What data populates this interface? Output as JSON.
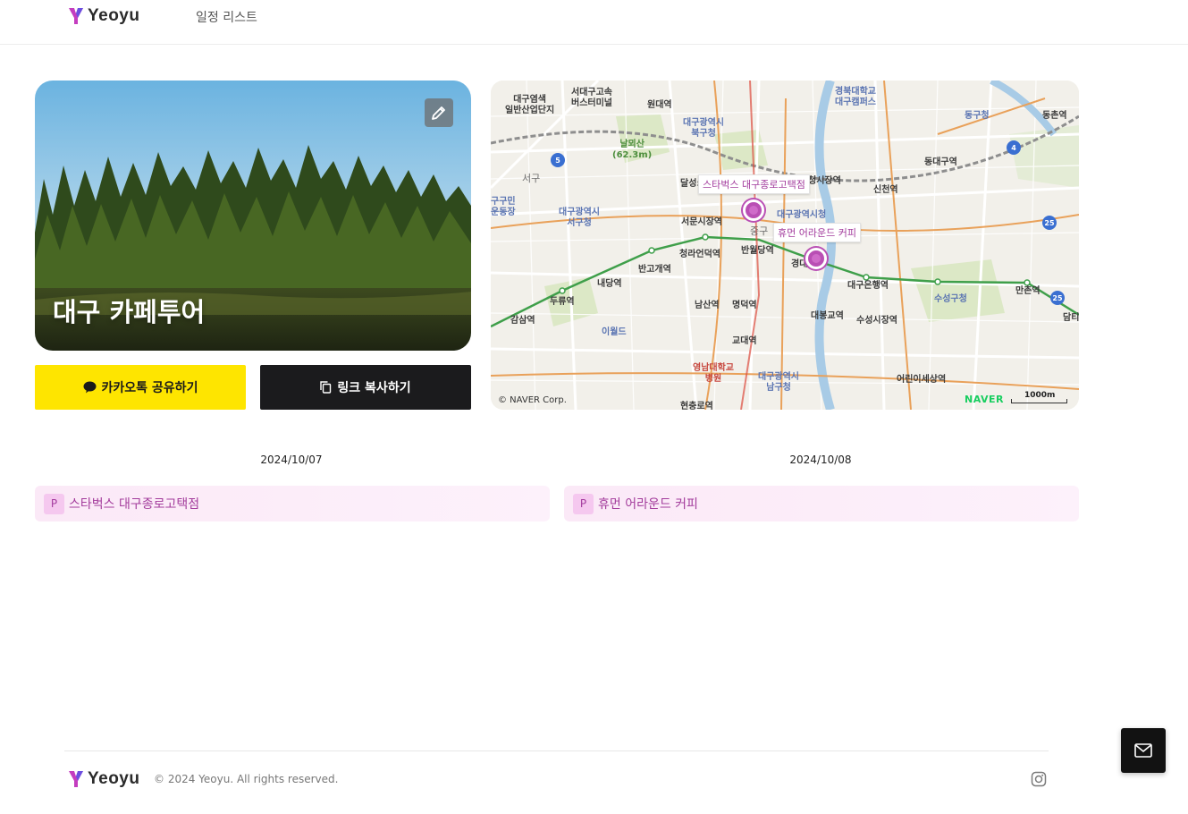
{
  "brand": {
    "name": "Yeoyu",
    "accent": "#b94fb4",
    "logo_icon": "y-logo-icon"
  },
  "nav": {
    "schedule_list": "일정 리스트"
  },
  "trip": {
    "title": "대구 카페투어",
    "edit_icon": "pencil-icon"
  },
  "actions": {
    "kakao_share": "카카오톡 공유하기",
    "kakao_icon": "chat-bubble-icon",
    "copy_link": "링크 복사하기",
    "copy_icon": "copy-icon"
  },
  "map": {
    "places": [
      {
        "name": "스타벅스 대구종로고택점"
      },
      {
        "name": "휴먼 어라운드 커피"
      }
    ],
    "labels": {
      "daegu_yeomsaek": "대구염색\n일반산업단지",
      "seodaegu_bus": "서대구고속\n버스터미널",
      "wondae": "원대역",
      "bukgu_office": "대구광역시\n북구청",
      "gyeongpook_univ": "경북대학교\n대구캠퍼스",
      "donggu_office": "동구청",
      "dongchon": "동촌역",
      "nalloesan": "날뫼산\n(62.3m)",
      "seogu": "서구",
      "dalseong": "달성:",
      "seongsijang": "청시장역",
      "sincheon": "신천역",
      "dongdaegu": "동대구역",
      "seogu_office": "대구광역시\n서구청",
      "seomun": "서문시장역",
      "city_hall": "대구광역시청",
      "junggu": "중구",
      "cheongna": "청라언덕역",
      "banwoldang": "반월당역",
      "gyeongdae": "경대",
      "bangogae": "반고개역",
      "naedang": "내당역",
      "duryu": "두류역",
      "namsan": "남산역",
      "myeongdeok": "명덕역",
      "daegu_bank": "대구은행역",
      "suseong_office": "수성구청",
      "mancheon": "만촌역",
      "damti": "담티",
      "gamsam": "감삼역",
      "eworld": "이월드",
      "daebong": "대봉교역",
      "suseong_market": "수성시장역",
      "gyodae": "교대역",
      "yeungnam_hospital": "영남대학교\n병원",
      "namgu_office": "대구광역시\n남구청",
      "children_park": "어린이세상역",
      "hyeonchungno": "현충로역",
      "guminundong": "구구민\n운동장"
    },
    "copyright": "© NAVER Corp.",
    "provider": "NAVER",
    "scale": "1000m"
  },
  "days": [
    {
      "date": "2024/10/07",
      "badge": "P",
      "place": "스타벅스 대구종로고택점"
    },
    {
      "date": "2024/10/08",
      "badge": "P",
      "place": "휴먼 어라운드 커피"
    }
  ],
  "footer": {
    "copyright": "© 2024 Yeoyu. All rights reserved.",
    "instagram_icon": "instagram-icon",
    "mail_icon": "mail-icon"
  }
}
